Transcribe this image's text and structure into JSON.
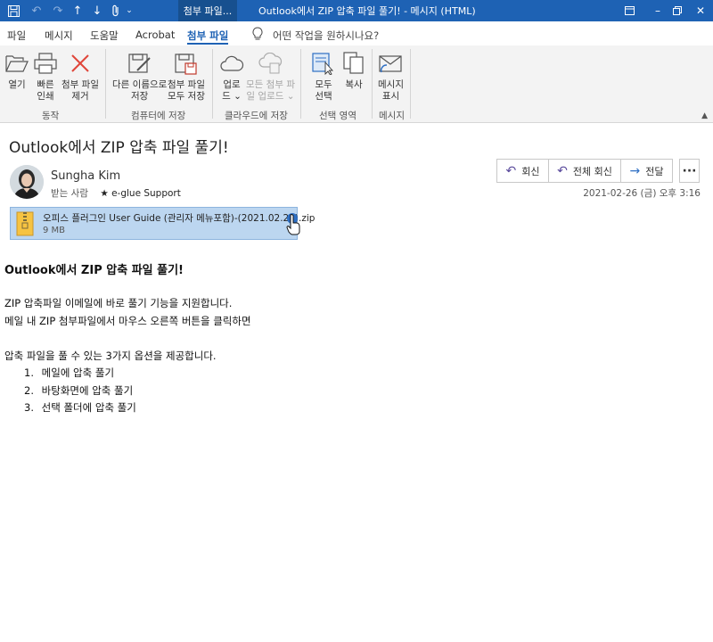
{
  "titlebar": {
    "context_tab": "첨부 파일...",
    "window_title": "Outlook에서 ZIP 압축 파일 풀기!  -  메시지 (HTML)"
  },
  "tabs": {
    "items": [
      "파일",
      "메시지",
      "도움말",
      "Acrobat",
      "첨부 파일"
    ],
    "active": "첨부 파일",
    "tell_me": "어떤 작업을 원하시나요?"
  },
  "ribbon": {
    "groups": [
      {
        "label": "동작",
        "buttons": [
          "열기",
          "빠른\n인쇄",
          "첨부 파일\n제거"
        ]
      },
      {
        "label": "컴퓨터에 저장",
        "buttons": [
          "다른 이름으로\n저장",
          "첨부 파일\n모두 저장"
        ]
      },
      {
        "label": "클라우드에 저장",
        "buttons": [
          "업로\n드 ⌄",
          "모든 첨부 파\n일 업로드 ⌄"
        ]
      },
      {
        "label": "선택 영역",
        "buttons": [
          "모두\n선택",
          "복사"
        ]
      },
      {
        "label": "메시지",
        "buttons": [
          "메시지\n표시"
        ]
      }
    ]
  },
  "message": {
    "subject": "Outlook에서 ZIP 압축 파일 풀기!",
    "sender": "Sungha Kim",
    "to_label": "받는 사람",
    "to_value": "★ e-glue Support",
    "actions": [
      "회신",
      "전체 회신",
      "전달"
    ],
    "datetime": "2021-02-26 (금) 오후 3:16",
    "attachment": {
      "name": "오피스 플러그인 User Guide (관리자 메뉴포함)-(2021.02.23).zip",
      "size": "9 MB"
    }
  },
  "body": {
    "heading": "Outlook에서 ZIP 압축 파일 풀기!",
    "paragraph1": [
      "ZIP 압축파일 이메일에 바로 풀기 기능을 지원합니다.",
      "메일 내 ZIP 첨부파일에서 마우스 오른쪽 버튼을 클릭하면"
    ],
    "intro": "압축 파일을 풀 수 있는 3가지 옵션을 제공합니다.",
    "options": [
      "메일에 압축 풀기",
      "바탕화면에 압축 풀기",
      "선택 폴더에 압축 풀기"
    ]
  },
  "icons": {
    "qa": [
      "save-icon",
      "undo-icon",
      "redo-icon",
      "arrow-up-icon",
      "arrow-down-icon",
      "paperclip-icon",
      "customize-icon"
    ],
    "window": [
      "ribbon-display-icon",
      "minimize-icon",
      "restore-icon",
      "close-icon"
    ]
  },
  "colors": {
    "titlebar": "#1e62b4",
    "accent": "#1e62b4",
    "attachment_selected": "#bcd6f0"
  }
}
